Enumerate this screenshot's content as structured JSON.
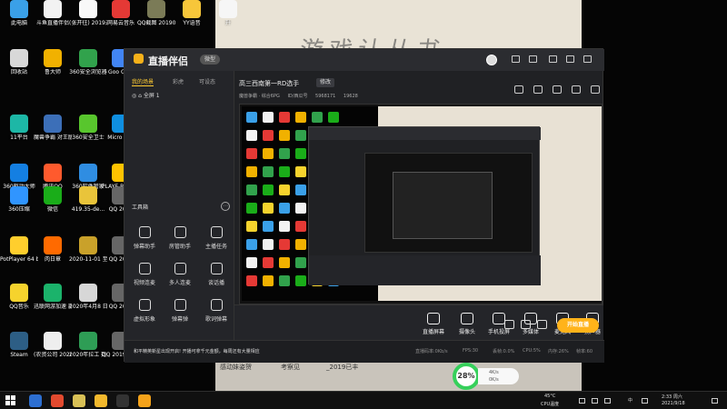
{
  "background": {
    "paper_heading": "游戏认从书",
    "lower_texts": [
      "感动妹姿贺",
      "考察见",
      "_2019已丰"
    ]
  },
  "desktop": {
    "icons": [
      {
        "label": "此电脑",
        "color": "#3aa0e8"
      },
      {
        "label": "斗鱼直播伴侣",
        "color": "#f2f2f2"
      },
      {
        "label": "(张开往)\n2019通话...",
        "color": "#f8f8f8"
      },
      {
        "label": "网易云音乐",
        "color": "#e53935"
      },
      {
        "label": "QQ截图\n20190819...",
        "color": "#7b7b57"
      },
      {
        "label": "YY语音",
        "color": "#f7c63a"
      },
      {
        "label": "升",
        "color": "#f6f6f6"
      },
      {
        "label": "回收站",
        "color": "#d8d8d8"
      },
      {
        "label": "鲁大师",
        "color": "#f1b100"
      },
      {
        "label": "360安全浏览器",
        "color": "#31a24c"
      },
      {
        "label": "Goo\nChro",
        "color": "#4285f4"
      },
      {
        "label": "11平台",
        "color": "#1db7a6"
      },
      {
        "label": "魔兽争霸\n对王版1.24E",
        "color": "#3c6fb8"
      },
      {
        "label": "360安全卫士",
        "color": "#58c62d"
      },
      {
        "label": "Micro\nEdg",
        "color": "#0f8fe1"
      },
      {
        "label": "360驱动大师",
        "color": "#147fe2"
      },
      {
        "label": "腾讯QQ",
        "color": "#ff5a2d"
      },
      {
        "label": "360软件管家",
        "color": "#2f8de2"
      },
      {
        "label": "PLAYE\nBATTLE",
        "color": "#ffc300"
      },
      {
        "label": "360压缩",
        "color": "#3095ff"
      },
      {
        "label": "微信",
        "color": "#1aad19"
      },
      {
        "label": "419.35-de...",
        "color": "#e9c43a"
      },
      {
        "label": "QQ\n2019",
        "color": "#666"
      },
      {
        "label": "PotPlayer 64\nbit",
        "color": "#ffce2d"
      },
      {
        "label": "肉日章",
        "color": "#ff6a00"
      },
      {
        "label": "2020-11-01\n至2020-11...",
        "color": "#c9a12a"
      },
      {
        "label": "QQ\n2019",
        "color": "#666"
      },
      {
        "label": "QQ音乐",
        "color": "#f6d32d"
      },
      {
        "label": "迅联网游加速\n器",
        "color": "#1bb36b"
      },
      {
        "label": "2020年4月8\n日农资公司...",
        "color": "#d7d7d7"
      },
      {
        "label": "QQ\n2019",
        "color": "#666"
      },
      {
        "label": "Steam",
        "color": "#2d5e85"
      },
      {
        "label": "(农资公司\n2020年4月...",
        "color": "#eeeeee"
      },
      {
        "label": "2020年拉工\n数据单跟 调...",
        "color": "#2e9d55"
      },
      {
        "label": "QQ\n20190604...",
        "color": "#666"
      }
    ]
  },
  "app": {
    "logo_text": "直播伴侣",
    "version_label": "微型",
    "tabs": [
      "我的场景",
      "彩虎",
      "可设态"
    ],
    "scene_name": "全屏 1",
    "room_title": "高三西南第一RD选手",
    "modify_label": "修改",
    "live_category": "魔兽争霸 · 综合6PG",
    "live_id": "ID/西瓜号",
    "room_no": "5968171",
    "fans": "19628",
    "toolbox_title": "工具箱",
    "tools": [
      "弹幕助手",
      "房管助手",
      "主播任务",
      "视频连麦",
      "多人连麦",
      "谈话播",
      "虚拟形象",
      "弹幕弹",
      "歌词弹幕"
    ],
    "actions": [
      "直播屏幕",
      "摄像头",
      "手机投屏",
      "多媒体",
      "麦克风",
      "扬声器"
    ],
    "start_live_label": "开始直播",
    "notice": "和平精英新星出现开启! 开播可拿千元金额，每周还有大量相应",
    "status_items": [
      "直播码率:0Kb/s",
      "FPS:30",
      "丢帧:0.0%",
      "CPU:5%",
      "内存:26%",
      "帧率:60"
    ]
  },
  "network_meter": {
    "percent": "28%",
    "upload": "4K/s",
    "download": "0K/s"
  },
  "taskbar": {
    "temperature": "45°C",
    "temperature_label": "CPU温度",
    "tray_language": "中",
    "time": "2:33 周六",
    "date": "2021/9/18"
  }
}
